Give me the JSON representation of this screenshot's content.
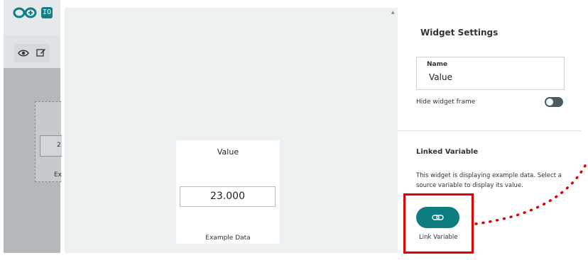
{
  "background_app": {
    "logo_text": "IO",
    "mini_value": "2",
    "mini_caption": "Ex"
  },
  "widget": {
    "title": "Value",
    "value": "23.000",
    "caption": "Example Data"
  },
  "panel": {
    "title": "Widget Settings",
    "name_label": "Name",
    "name_value": "Value",
    "hide_frame_label": "Hide widget frame",
    "hide_frame_enabled": false,
    "linked_title": "Linked Variable",
    "linked_desc": "This widget is displaying example data. Select a source variable to display its value.",
    "link_button_label": "Link Variable"
  },
  "colors": {
    "accent": "#0e7d80",
    "highlight": "#e10000",
    "toggle_off": "#4e5b61"
  },
  "icons": {
    "logo": "infinity-logo-icon",
    "view": "eye-icon",
    "edit": "edit-pencil-icon",
    "link": "link-chain-icon"
  }
}
